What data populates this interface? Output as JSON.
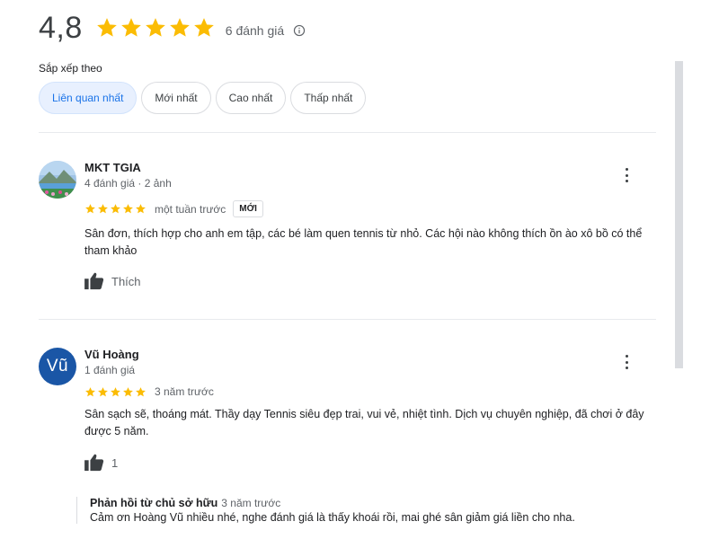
{
  "summary": {
    "rating": "4,8",
    "star_count": 5,
    "review_count_label": "6 đánh giá",
    "star_color": "#fbbc04"
  },
  "sort": {
    "label": "Sắp xếp theo",
    "options": [
      "Liên quan nhất",
      "Mới nhất",
      "Cao nhất",
      "Thấp nhất"
    ],
    "selected": "Liên quan nhất"
  },
  "reviews": [
    {
      "author": "MKT TGIA",
      "meta": "4 đánh giá · 2 ảnh",
      "stars": 5,
      "time": "một tuần trước",
      "badge": "MỚI",
      "text": "Sân đơn, thích hợp cho anh em tập, các bé làm quen tennis từ nhỏ. Các hội nào không thích ồn ào xô bồ có thể tham khảo",
      "like_label": "Thích"
    },
    {
      "author": "Vũ Hoàng",
      "avatar_letter": "Vũ",
      "meta": "1 đánh giá",
      "stars": 5,
      "time": "3 năm trước",
      "text": "Sân sạch sẽ, thoáng mát. Thầy dạy Tennis siêu đẹp trai, vui vẻ, nhiệt tình. Dịch vụ chuyên nghiệp, đã chơi ở đây được 5 năm.",
      "like_label": "1",
      "owner_reply": {
        "title": "Phản hồi từ chủ sở hữu",
        "time": "3 năm trước",
        "text": "Cảm ơn Hoàng Vũ nhiều nhé, nghe đánh giá là thấy khoái rồi, mai ghé sân giảm giá liền cho nha."
      }
    }
  ]
}
